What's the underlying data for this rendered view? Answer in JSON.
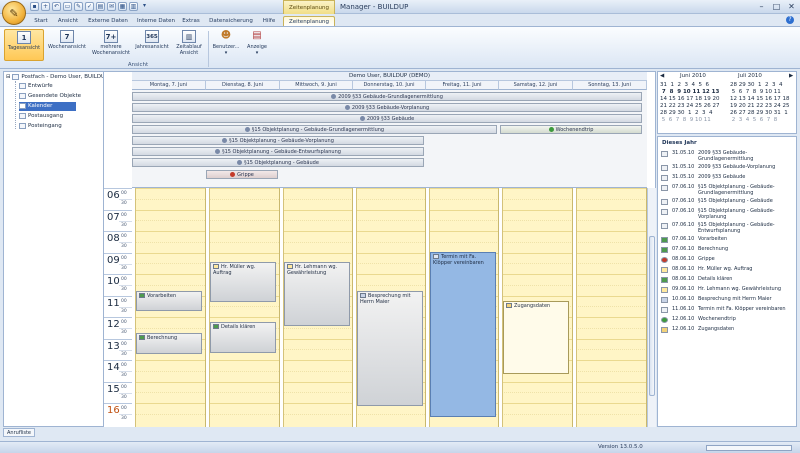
{
  "app": {
    "title": "Manager - BUILDUP",
    "context_tab_title": "Zeitenplanung"
  },
  "tabs": [
    "Start",
    "Ansicht",
    "Externe Daten",
    "Interne Daten",
    "Extras",
    "Datensicherung",
    "Hilfe",
    "Zeitenplanung"
  ],
  "ribbon": {
    "buttons": [
      "Tagesansicht",
      "Wochenansicht",
      "mehrere Wochenansicht",
      "Jahresansicht",
      "Zeitablauf Ansicht",
      "Benutzer...",
      "Anzeige"
    ],
    "icons": [
      "1",
      "7",
      "7+",
      "365"
    ],
    "group_label": "Ansicht"
  },
  "tree": {
    "root": "Postfach - Demo User, BUILDUP",
    "items": [
      "Entwürfe",
      "Gesendete Objekte",
      "Kalender",
      "Postausgang",
      "Posteingang"
    ]
  },
  "calendar": {
    "owner": "Demo User, BUILDUP (DEMO)",
    "days": [
      "Montag, 7. Juni",
      "Dienstag, 8. Juni",
      "Mittwoch, 9. Juni",
      "Donnerstag, 10. Juni",
      "Freitag, 11. Juni",
      "Samstag, 12. Juni",
      "Sonntag, 13. Juni"
    ],
    "allday": [
      "2009 §33 Gebäude-Grundlagenermittlung",
      "2009 §33 Gebäude-Vorplanung",
      "2009 §33 Gebäude",
      "§15 Objektplanung - Gebäude-Grundlagenermittlung",
      "Wochenendtrip",
      "§15 Objektplanung - Gebäude-Vorplanung",
      "§15 Objektplanung - Gebäude-Entwurfsplanung",
      "§15 Objektplanung - Gebäude",
      "Grippe"
    ],
    "hours": [
      "06",
      "07",
      "08",
      "09",
      "10",
      "11",
      "12",
      "13",
      "14",
      "15",
      "16"
    ],
    "half": "30",
    "minutes_label": "00",
    "appointments": [
      "Vorarbeiten",
      "Berechnung",
      "Hr. Müller wg. Auftrag",
      "Details klären",
      "Hr. Lehmann wg. Gewährleistung",
      "Besprechung mit Herrn Maier",
      "Termin mit Fa. Klöpper vereinbaren",
      "Zugangsdaten"
    ]
  },
  "mini": {
    "june": {
      "title": "Juni 2010",
      "rows": [
        "31  1  2  3  4  5  6",
        " 7  8  9 10 11 12 13",
        "14 15 16 17 18 19 20",
        "21 22 23 24 25 26 27",
        "28 29 30  1  2  3  4",
        " 5  6  7  8  9 10 11"
      ]
    },
    "july": {
      "title": "Juli 2010",
      "rows": [
        "28 29 30  1  2  3  4",
        " 5  6  7  8  9 10 11",
        "12 13 14 15 16 17 18",
        "19 20 21 22 23 24 25",
        "26 27 28 29 30 31  1",
        " 2  3  4  5  6  7  8"
      ]
    }
  },
  "yearlist": {
    "title": "Dieses Jahr",
    "items": [
      {
        "date": "31.05.10",
        "text": "2009 §33 Gebäude-Grundlagenermittlung"
      },
      {
        "date": "31.05.10",
        "text": "2009 §33 Gebäude-Vorplanung"
      },
      {
        "date": "31.05.10",
        "text": "2009 §33 Gebäude"
      },
      {
        "date": "07.06.10",
        "text": "§15 Objektplanung - Gebäude-Grundlagenermittlung"
      },
      {
        "date": "07.06.10",
        "text": "§15 Objektplanung - Gebäude"
      },
      {
        "date": "07.06.10",
        "text": "§15 Objektplanung - Gebäude-Vorplanung"
      },
      {
        "date": "07.06.10",
        "text": "§15 Objektplanung - Gebäude-Entwurfsplanung"
      },
      {
        "date": "07.06.10",
        "text": "Vorarbeiten"
      },
      {
        "date": "07.06.10",
        "text": "Berechnung"
      },
      {
        "date": "08.06.10",
        "text": "Grippe"
      },
      {
        "date": "08.06.10",
        "text": "Hr. Müller wg. Auftrag"
      },
      {
        "date": "08.06.10",
        "text": "Details klären"
      },
      {
        "date": "09.06.10",
        "text": "Hr. Lehmann wg. Gewährleistung"
      },
      {
        "date": "10.06.10",
        "text": "Besprechung mit Herrn Maier"
      },
      {
        "date": "11.06.10",
        "text": "Termin mit Fa. Klöpper vereinbaren"
      },
      {
        "date": "12.06.10",
        "text": "Wochenendtrip"
      },
      {
        "date": "12.06.10",
        "text": "Zugangsdaten"
      }
    ]
  },
  "footer": {
    "tab": "Anrufliste",
    "version": "Version 13.0.5.0"
  }
}
